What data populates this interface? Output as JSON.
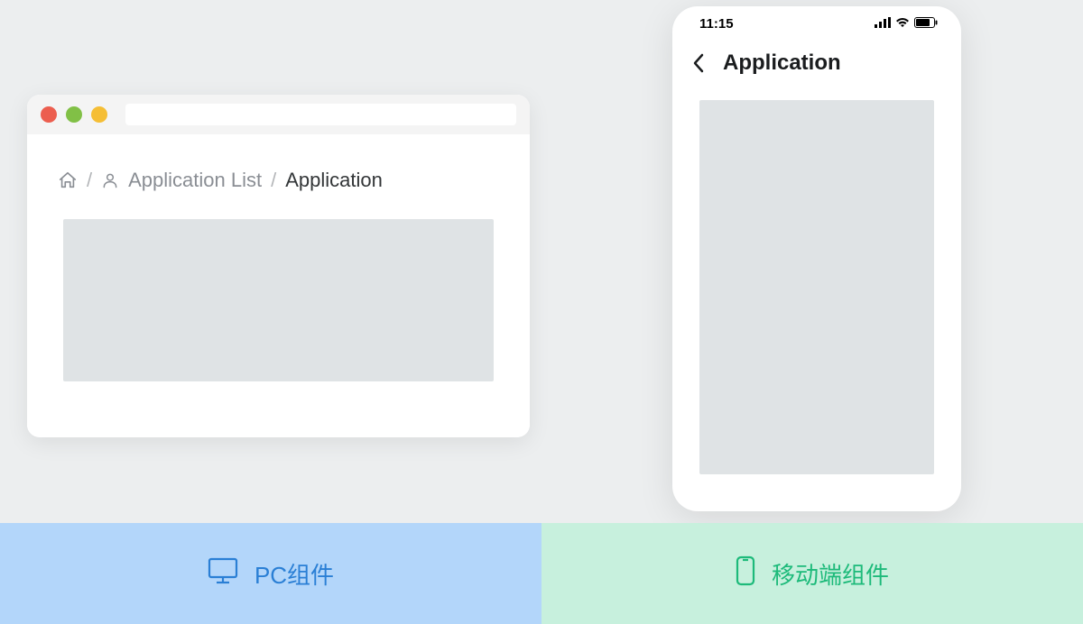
{
  "browser": {
    "breadcrumb": {
      "link_label": "Application List",
      "current_label": "Application"
    }
  },
  "mobile": {
    "status_time": "11:15",
    "title": "Application"
  },
  "labels": {
    "pc": "PC组件",
    "mobile": "移动端组件"
  }
}
